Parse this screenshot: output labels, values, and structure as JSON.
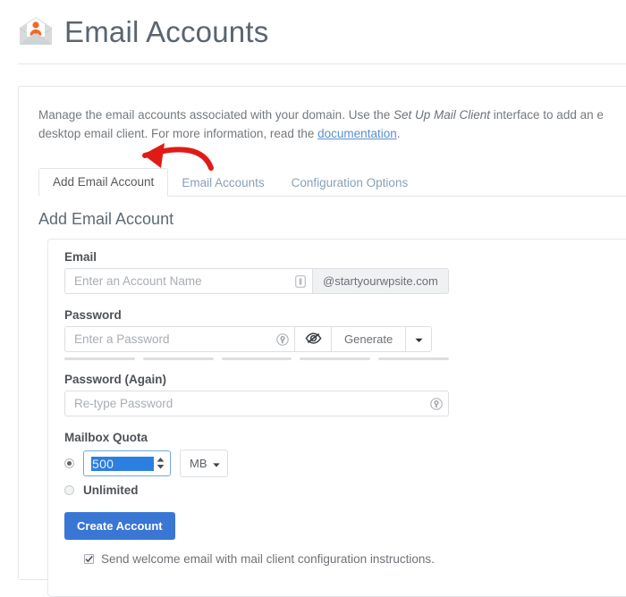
{
  "header": {
    "title": "Email Accounts",
    "icon": "envelope-user-icon"
  },
  "description": {
    "line1_a": "Manage the email accounts associated with your domain. Use the ",
    "line1_italic": "Set Up Mail Client",
    "line1_b": " interface to add an e",
    "line2_a": "desktop email client. For more information, read the ",
    "line2_link": "documentation",
    "line2_b": "."
  },
  "tabs": [
    {
      "label": "Add Email Account",
      "active": true
    },
    {
      "label": "Email Accounts",
      "active": false
    },
    {
      "label": "Configuration Options",
      "active": false
    }
  ],
  "section": {
    "title": "Add Email Account"
  },
  "form": {
    "email": {
      "label": "Email",
      "placeholder": "Enter an Account Name",
      "input_icon": "clipboard-icon",
      "domain_suffix": "@startyourwpsite.com"
    },
    "password": {
      "label": "Password",
      "placeholder": "Enter a Password",
      "input_icon": "key-icon",
      "toggle_icon": "eye-slash-icon",
      "generate_label": "Generate",
      "caret_icon": "chevron-down-icon",
      "strength_segments": 5
    },
    "password_again": {
      "label": "Password (Again)",
      "placeholder": "Re-type Password",
      "input_icon": "key-icon"
    },
    "quota": {
      "label": "Mailbox Quota",
      "value": "500",
      "unit": "MB",
      "unit_caret_icon": "caret-down-icon",
      "spinner_icon": "spinner-updown-icon",
      "quota_radio_selected": true,
      "unlimited_label": "Unlimited",
      "unlimited_radio_selected": false
    },
    "submit_label": "Create Account",
    "welcome_email": {
      "label": "Send welcome email with mail client configuration instructions.",
      "checked": true
    }
  },
  "annotation": {
    "type": "red-arrow",
    "color": "#e01b16",
    "points_to": "Add Email Account"
  },
  "colors": {
    "accent_blue": "#3a77d4",
    "title_gray": "#5a6570",
    "icon_orange": "#f1682a",
    "selection_blue": "#2b7fe0"
  }
}
